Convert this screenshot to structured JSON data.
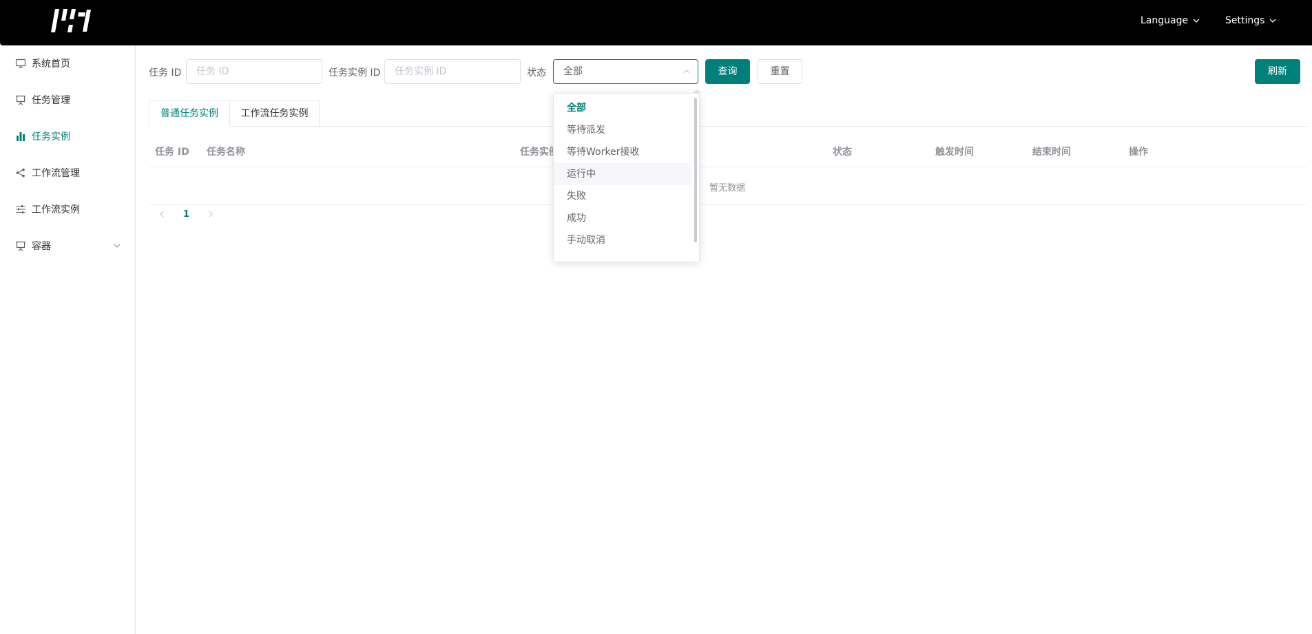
{
  "header": {
    "language_label": "Language",
    "settings_label": "Settings"
  },
  "sidebar": {
    "items": [
      {
        "label": "系统首页",
        "icon": "monitor-icon"
      },
      {
        "label": "任务管理",
        "icon": "presentation-icon"
      },
      {
        "label": "任务实例",
        "icon": "bar-chart-icon"
      },
      {
        "label": "工作流管理",
        "icon": "share-icon"
      },
      {
        "label": "工作流实例",
        "icon": "sliders-icon"
      },
      {
        "label": "容器",
        "icon": "presentation-icon"
      }
    ],
    "active_label": "任务实例"
  },
  "filters": {
    "task_id_label": "任务 ID",
    "task_id_placeholder": "任务 ID",
    "instance_id_label": "任务实例 ID",
    "instance_id_placeholder": "任务实例 ID",
    "status_label": "状态",
    "status_value": "全部",
    "query_button": "查询",
    "reset_button": "重置",
    "refresh_button": "刷新"
  },
  "tabs": [
    {
      "label": "普通任务实例",
      "active": true
    },
    {
      "label": "工作流任务实例",
      "active": false
    }
  ],
  "table": {
    "columns": [
      "任务 ID",
      "任务名称",
      "任务实例",
      "状态",
      "触发时间",
      "结束时间",
      "操作"
    ],
    "empty_text": "暂无数据"
  },
  "pagination": {
    "current_page": "1"
  },
  "status_dropdown": {
    "options": [
      "全部",
      "等待派发",
      "等待Worker接收",
      "运行中",
      "失败",
      "成功",
      "手动取消"
    ],
    "selected": "全部",
    "hovered": "运行中"
  },
  "colors": {
    "accent": "#00807a",
    "header_bg": "#000000"
  }
}
